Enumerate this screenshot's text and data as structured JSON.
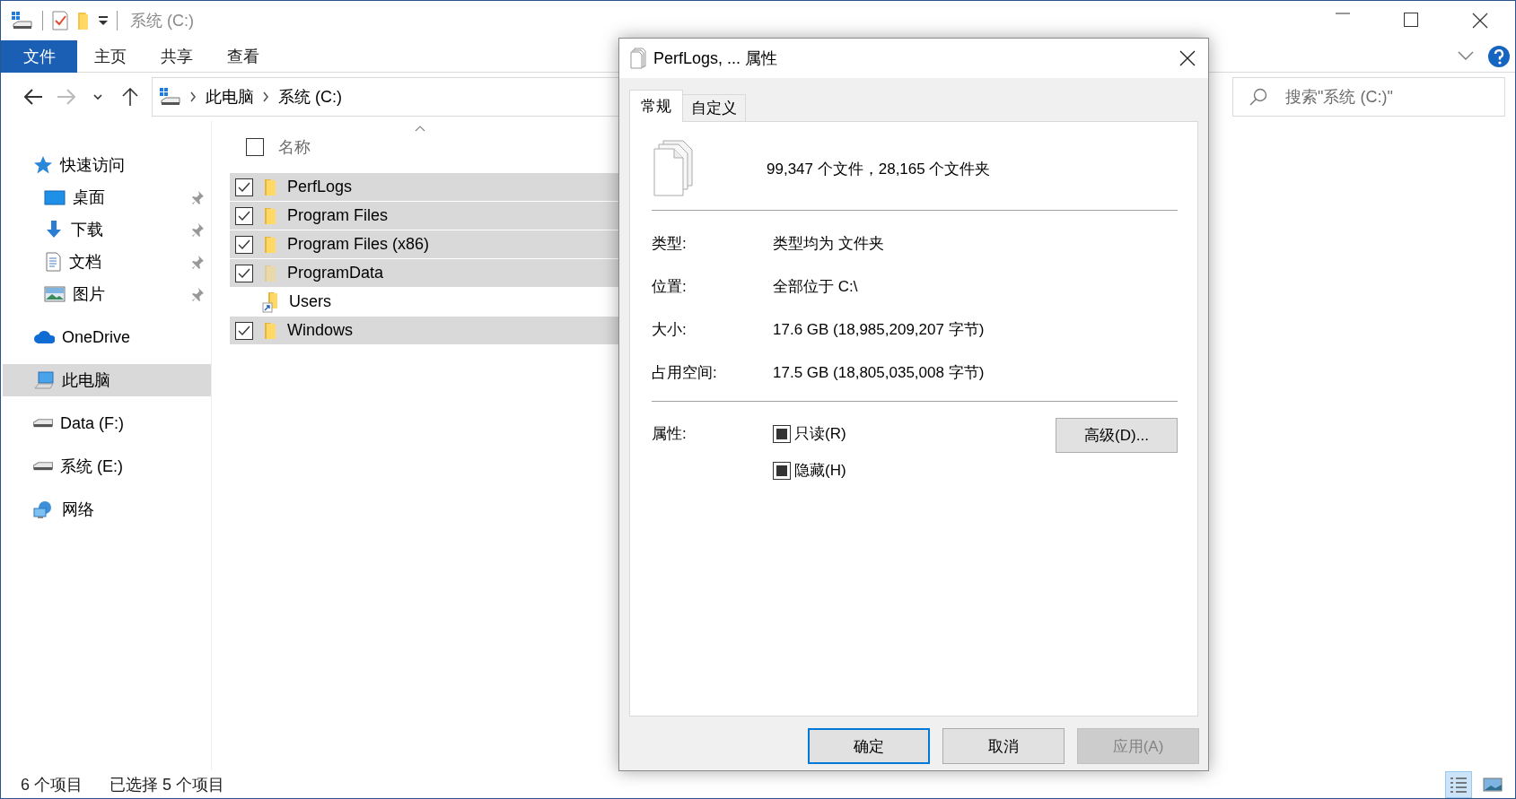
{
  "window": {
    "title": "系统 (C:)"
  },
  "ribbon_tabs": [
    {
      "label": "文件",
      "kind": "file",
      "selected": false
    },
    {
      "label": "主页",
      "kind": "tab",
      "selected": false
    },
    {
      "label": "共享",
      "kind": "tab",
      "selected": false
    },
    {
      "label": "查看",
      "kind": "tab",
      "selected": false
    }
  ],
  "address": {
    "breadcrumbs": [
      "此电脑",
      "系统 (C:)"
    ]
  },
  "search": {
    "placeholder": "搜索\"系统 (C:)\""
  },
  "sidebar": {
    "items": [
      {
        "label": "快速访问",
        "kind": "star",
        "selected": false,
        "children": [
          {
            "label": "桌面",
            "kind": "desktop",
            "selected": false,
            "pinned": true
          },
          {
            "label": "下载",
            "kind": "download",
            "selected": false,
            "pinned": true
          },
          {
            "label": "文档",
            "kind": "document",
            "selected": false,
            "pinned": true
          },
          {
            "label": "图片",
            "kind": "picture",
            "selected": false,
            "pinned": true
          }
        ]
      },
      {
        "label": "OneDrive",
        "kind": "cloud",
        "selected": false
      },
      {
        "label": "此电脑",
        "kind": "computer",
        "selected": true
      },
      {
        "label": "Data (F:)",
        "kind": "drive",
        "selected": false
      },
      {
        "label": "系统 (E:)",
        "kind": "drive",
        "selected": false
      },
      {
        "label": "网络",
        "kind": "network",
        "selected": false
      }
    ]
  },
  "file_list": {
    "column": "名称",
    "header_checked": false,
    "rows": [
      {
        "name": "PerfLogs",
        "kind": "folder",
        "hidden": false,
        "selected": true,
        "checked": true
      },
      {
        "name": "Program Files",
        "kind": "folder",
        "hidden": false,
        "selected": true,
        "checked": true
      },
      {
        "name": "Program Files (x86)",
        "kind": "folder",
        "hidden": false,
        "selected": true,
        "checked": true
      },
      {
        "name": "ProgramData",
        "kind": "folder",
        "hidden": true,
        "selected": true,
        "checked": true
      },
      {
        "name": "Users",
        "kind": "shortcut",
        "hidden": false,
        "selected": false,
        "checked": false
      },
      {
        "name": "Windows",
        "kind": "folder",
        "hidden": false,
        "selected": true,
        "checked": true
      }
    ]
  },
  "status_bar": {
    "count": "6 个项目",
    "selection": "已选择 5 个项目",
    "views": [
      {
        "kind": "details",
        "selected": true
      },
      {
        "kind": "tiles",
        "selected": false
      }
    ]
  },
  "dialog": {
    "title": "PerfLogs, ... 属性",
    "tabs": [
      {
        "label": "常规",
        "selected": true
      },
      {
        "label": "自定义",
        "selected": false
      }
    ],
    "summary": "99,347 个文件，28,165 个文件夹",
    "properties": [
      {
        "label": "类型:",
        "value": "类型均为 文件夹"
      },
      {
        "label": "位置:",
        "value": "全部位于 C:\\"
      },
      {
        "label": "大小:",
        "value": "17.6 GB (18,985,209,207 字节)"
      },
      {
        "label": "占用空间:",
        "value": "17.5 GB (18,805,035,008 字节)"
      }
    ],
    "attributes_label": "属性:",
    "attributes": [
      {
        "label": "只读(R)",
        "indeterminate": true
      },
      {
        "label": "隐藏(H)",
        "indeterminate": true
      }
    ],
    "advanced_button": "高级(D)...",
    "buttons": [
      {
        "label": "确定",
        "kind": "default"
      },
      {
        "label": "取消",
        "kind": "normal"
      },
      {
        "label": "应用(A)",
        "kind": "disabled"
      }
    ]
  }
}
